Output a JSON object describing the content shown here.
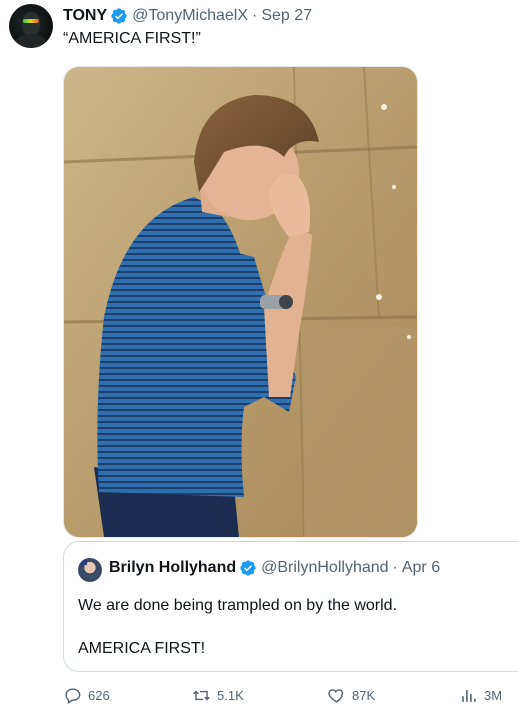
{
  "tweet": {
    "author_name": "TONY",
    "author_handle": "@TonyMichaelX",
    "separator": "·",
    "date": "Sep 27",
    "text": "“AMERICA FIRST!”"
  },
  "quoted_tweet": {
    "author_name": "Brilyn Hollyhand",
    "author_handle": "@BrilynHollyhand",
    "separator": "·",
    "date": "Apr 6",
    "text_line1": "We are done being trampled on by the world.",
    "text_line2": "AMERICA FIRST!"
  },
  "actions": {
    "replies": "626",
    "reposts": "5.1K",
    "likes": "87K",
    "views": "3M"
  },
  "colors": {
    "verified_blue": "#1d9bf0",
    "secondary_text": "#536471",
    "primary_text": "#0f1419",
    "border": "#cfd9de"
  },
  "icons": [
    "verified-badge-icon",
    "reply-icon",
    "repost-icon",
    "like-icon",
    "views-icon"
  ]
}
